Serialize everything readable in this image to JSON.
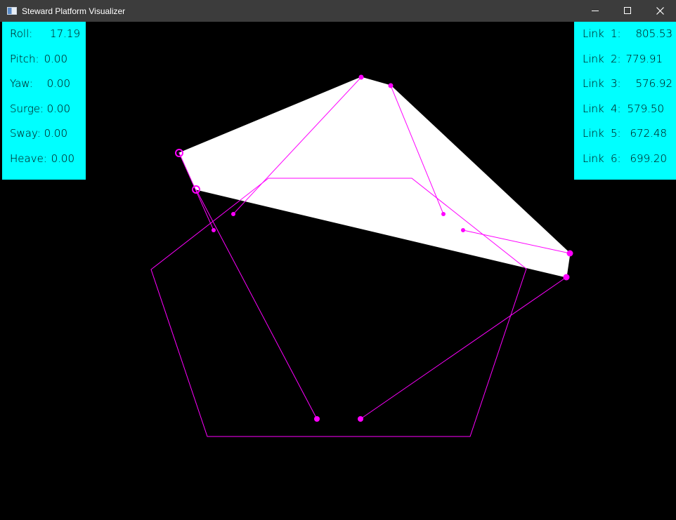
{
  "window": {
    "title": "Steward Platform Visualizer",
    "controls": {
      "minimize": "minimize-icon",
      "maximize": "maximize-icon",
      "close": "close-icon"
    }
  },
  "colors": {
    "titlebar": "#3c3c3c",
    "panel": "#00ffff",
    "background": "#000000",
    "platform_fill": "#ffffff",
    "links": "#ff00ff"
  },
  "parameters": [
    {
      "label": "Roll:",
      "value": "17.19"
    },
    {
      "label": "Pitch:",
      "value": "0.00"
    },
    {
      "label": "Yaw:",
      "value": "0.00"
    },
    {
      "label": "Surge:",
      "value": "0.00"
    },
    {
      "label": "Sway:",
      "value": "0.00"
    },
    {
      "label": "Heave:",
      "value": "0.00"
    }
  ],
  "links": [
    {
      "label": "Link",
      "num": "1:",
      "value": "805.53"
    },
    {
      "label": "Link",
      "num": "2:",
      "value": "779.91"
    },
    {
      "label": "Link",
      "num": "3:",
      "value": "576.92"
    },
    {
      "label": "Link",
      "num": "4:",
      "value": "579.50"
    },
    {
      "label": "Link",
      "num": "5:",
      "value": "672.48"
    },
    {
      "label": "Link",
      "num": "6:",
      "value": "699.20"
    }
  ]
}
